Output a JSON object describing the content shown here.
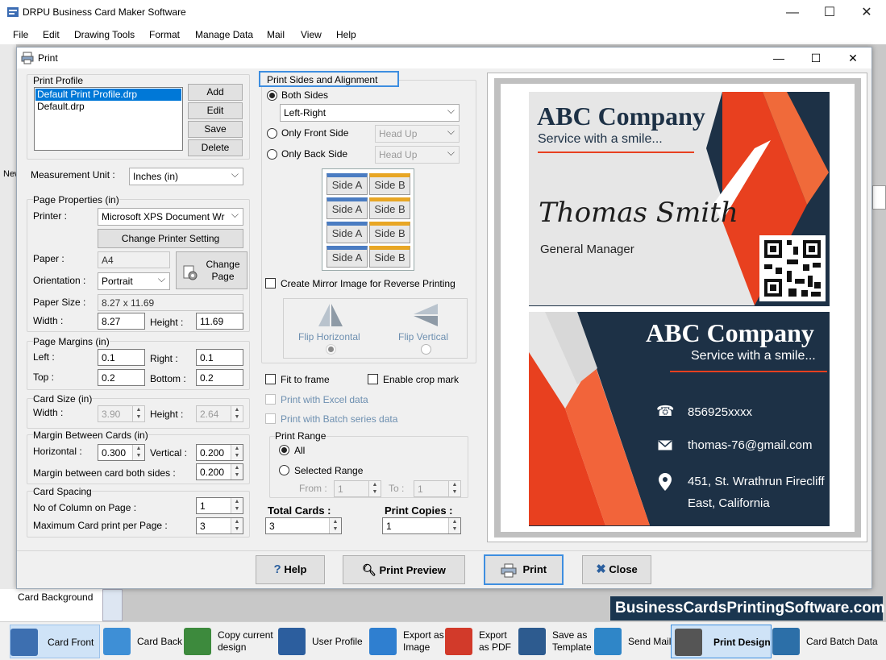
{
  "app": {
    "title": "DRPU Business Card Maker Software"
  },
  "menu": [
    "File",
    "Edit",
    "Drawing Tools",
    "Format",
    "Manage Data",
    "Mail",
    "View",
    "Help"
  ],
  "dialog": {
    "title": "Print",
    "print_profile": {
      "legend": "Print Profile",
      "items": [
        "Default Print Profile.drp",
        "Default.drp"
      ],
      "buttons": {
        "add": "Add",
        "edit": "Edit",
        "save": "Save",
        "delete": "Delete"
      }
    },
    "measurement": {
      "label": "Measurement Unit :",
      "value": "Inches (in)"
    },
    "page_properties": {
      "legend": "Page Properties (in)",
      "printer_label": "Printer :",
      "printer_value": "Microsoft XPS Document Wr",
      "change_printer": "Change Printer Setting",
      "paper_label": "Paper :",
      "paper_value": "A4",
      "change_page": "Change Page",
      "orientation_label": "Orientation :",
      "orientation_value": "Portrait",
      "paper_size_label": "Paper Size :",
      "paper_size_value": "8.27 x 11.69",
      "width_label": "Width :",
      "width_value": "8.27",
      "height_label": "Height :",
      "height_value": "11.69"
    },
    "page_margins": {
      "legend": "Page Margins (in)",
      "left_label": "Left :",
      "left_value": "0.1",
      "right_label": "Right :",
      "right_value": "0.1",
      "top_label": "Top :",
      "top_value": "0.2",
      "bottom_label": "Bottom :",
      "bottom_value": "0.2"
    },
    "card_size": {
      "legend": "Card Size (in)",
      "width_label": "Width :",
      "width_value": "3.90",
      "height_label": "Height :",
      "height_value": "2.64"
    },
    "margin_between": {
      "legend": "Margin Between Cards (in)",
      "horizontal_label": "Horizontal :",
      "horizontal_value": "0.300",
      "vertical_label": "Vertical :",
      "vertical_value": "0.200",
      "both_label": "Margin between card both sides :",
      "both_value": "0.200"
    },
    "card_spacing": {
      "legend": "Card Spacing",
      "columns_label": "No of Column on Page :",
      "columns_value": "1",
      "max_label": "Maximum Card print per Page :",
      "max_value": "3"
    },
    "sides": {
      "legend": "Print Sides and Alignment",
      "both": "Both Sides",
      "both_value": "Left-Right",
      "front": "Only Front Side",
      "front_value": "Head Up",
      "back": "Only Back Side",
      "back_value": "Head Up",
      "side_a": "Side A",
      "side_b": "Side B",
      "mirror": "Create Mirror Image for Reverse Printing",
      "flip_h": "Flip Horizontal",
      "flip_v": "Flip Vertical"
    },
    "options": {
      "fit": "Fit to frame",
      "crop": "Enable crop mark",
      "excel": "Print with Excel data",
      "batch": "Print with Batch series data"
    },
    "print_range": {
      "legend": "Print Range",
      "all": "All",
      "selected": "Selected Range",
      "from_label": "From :",
      "from_value": "1",
      "to_label": "To :",
      "to_value": "1"
    },
    "totals": {
      "total_label": "Total Cards :",
      "total_value": "3",
      "copies_label": "Print Copies :",
      "copies_value": "1"
    },
    "buttons": {
      "help": "Help",
      "preview": "Print Preview",
      "print": "Print",
      "close": "Close"
    }
  },
  "card": {
    "company": "ABC Company",
    "slogan": "Service with a smile...",
    "name": "Thomas Smith",
    "position": "General Manager",
    "phone": "856925xxxx",
    "email": "thomas-76@gmail.com",
    "address1": "451, St. Wrathrun Firecliff",
    "address2": "East, California"
  },
  "left_panel": {
    "label": "Card Background",
    "new_label": "New"
  },
  "watermark": "BusinessCardsPrintingSoftware.com",
  "toolbar": [
    {
      "label": "Card Front",
      "icon": "card-front-icon",
      "color": "#3d6fb0"
    },
    {
      "label": "Card Back",
      "icon": "card-back-icon",
      "color": "#3e8fd6"
    },
    {
      "label": "Copy current design",
      "icon": "copy-design-icon",
      "color": "#3d8a3d"
    },
    {
      "label": "User Profile",
      "icon": "user-profile-icon",
      "color": "#2c5e9e"
    },
    {
      "label": "Export as Image",
      "icon": "export-image-icon",
      "color": "#2f7fd0"
    },
    {
      "label": "Export as PDF",
      "icon": "export-pdf-icon",
      "color": "#d23a2a"
    },
    {
      "label": "Save as Template",
      "icon": "save-template-icon",
      "color": "#2d5b8f"
    },
    {
      "label": "Send Mail",
      "icon": "send-mail-icon",
      "color": "#2f86c8"
    },
    {
      "label": "Print Design",
      "icon": "print-design-icon",
      "color": "#555555"
    },
    {
      "label": "Card Batch Data",
      "icon": "card-batch-icon",
      "color": "#2c6fa8"
    }
  ],
  "colors": {
    "card_dark": "#1d3146",
    "card_red": "#e8401f",
    "accent_blue": "#3d8ee0"
  }
}
